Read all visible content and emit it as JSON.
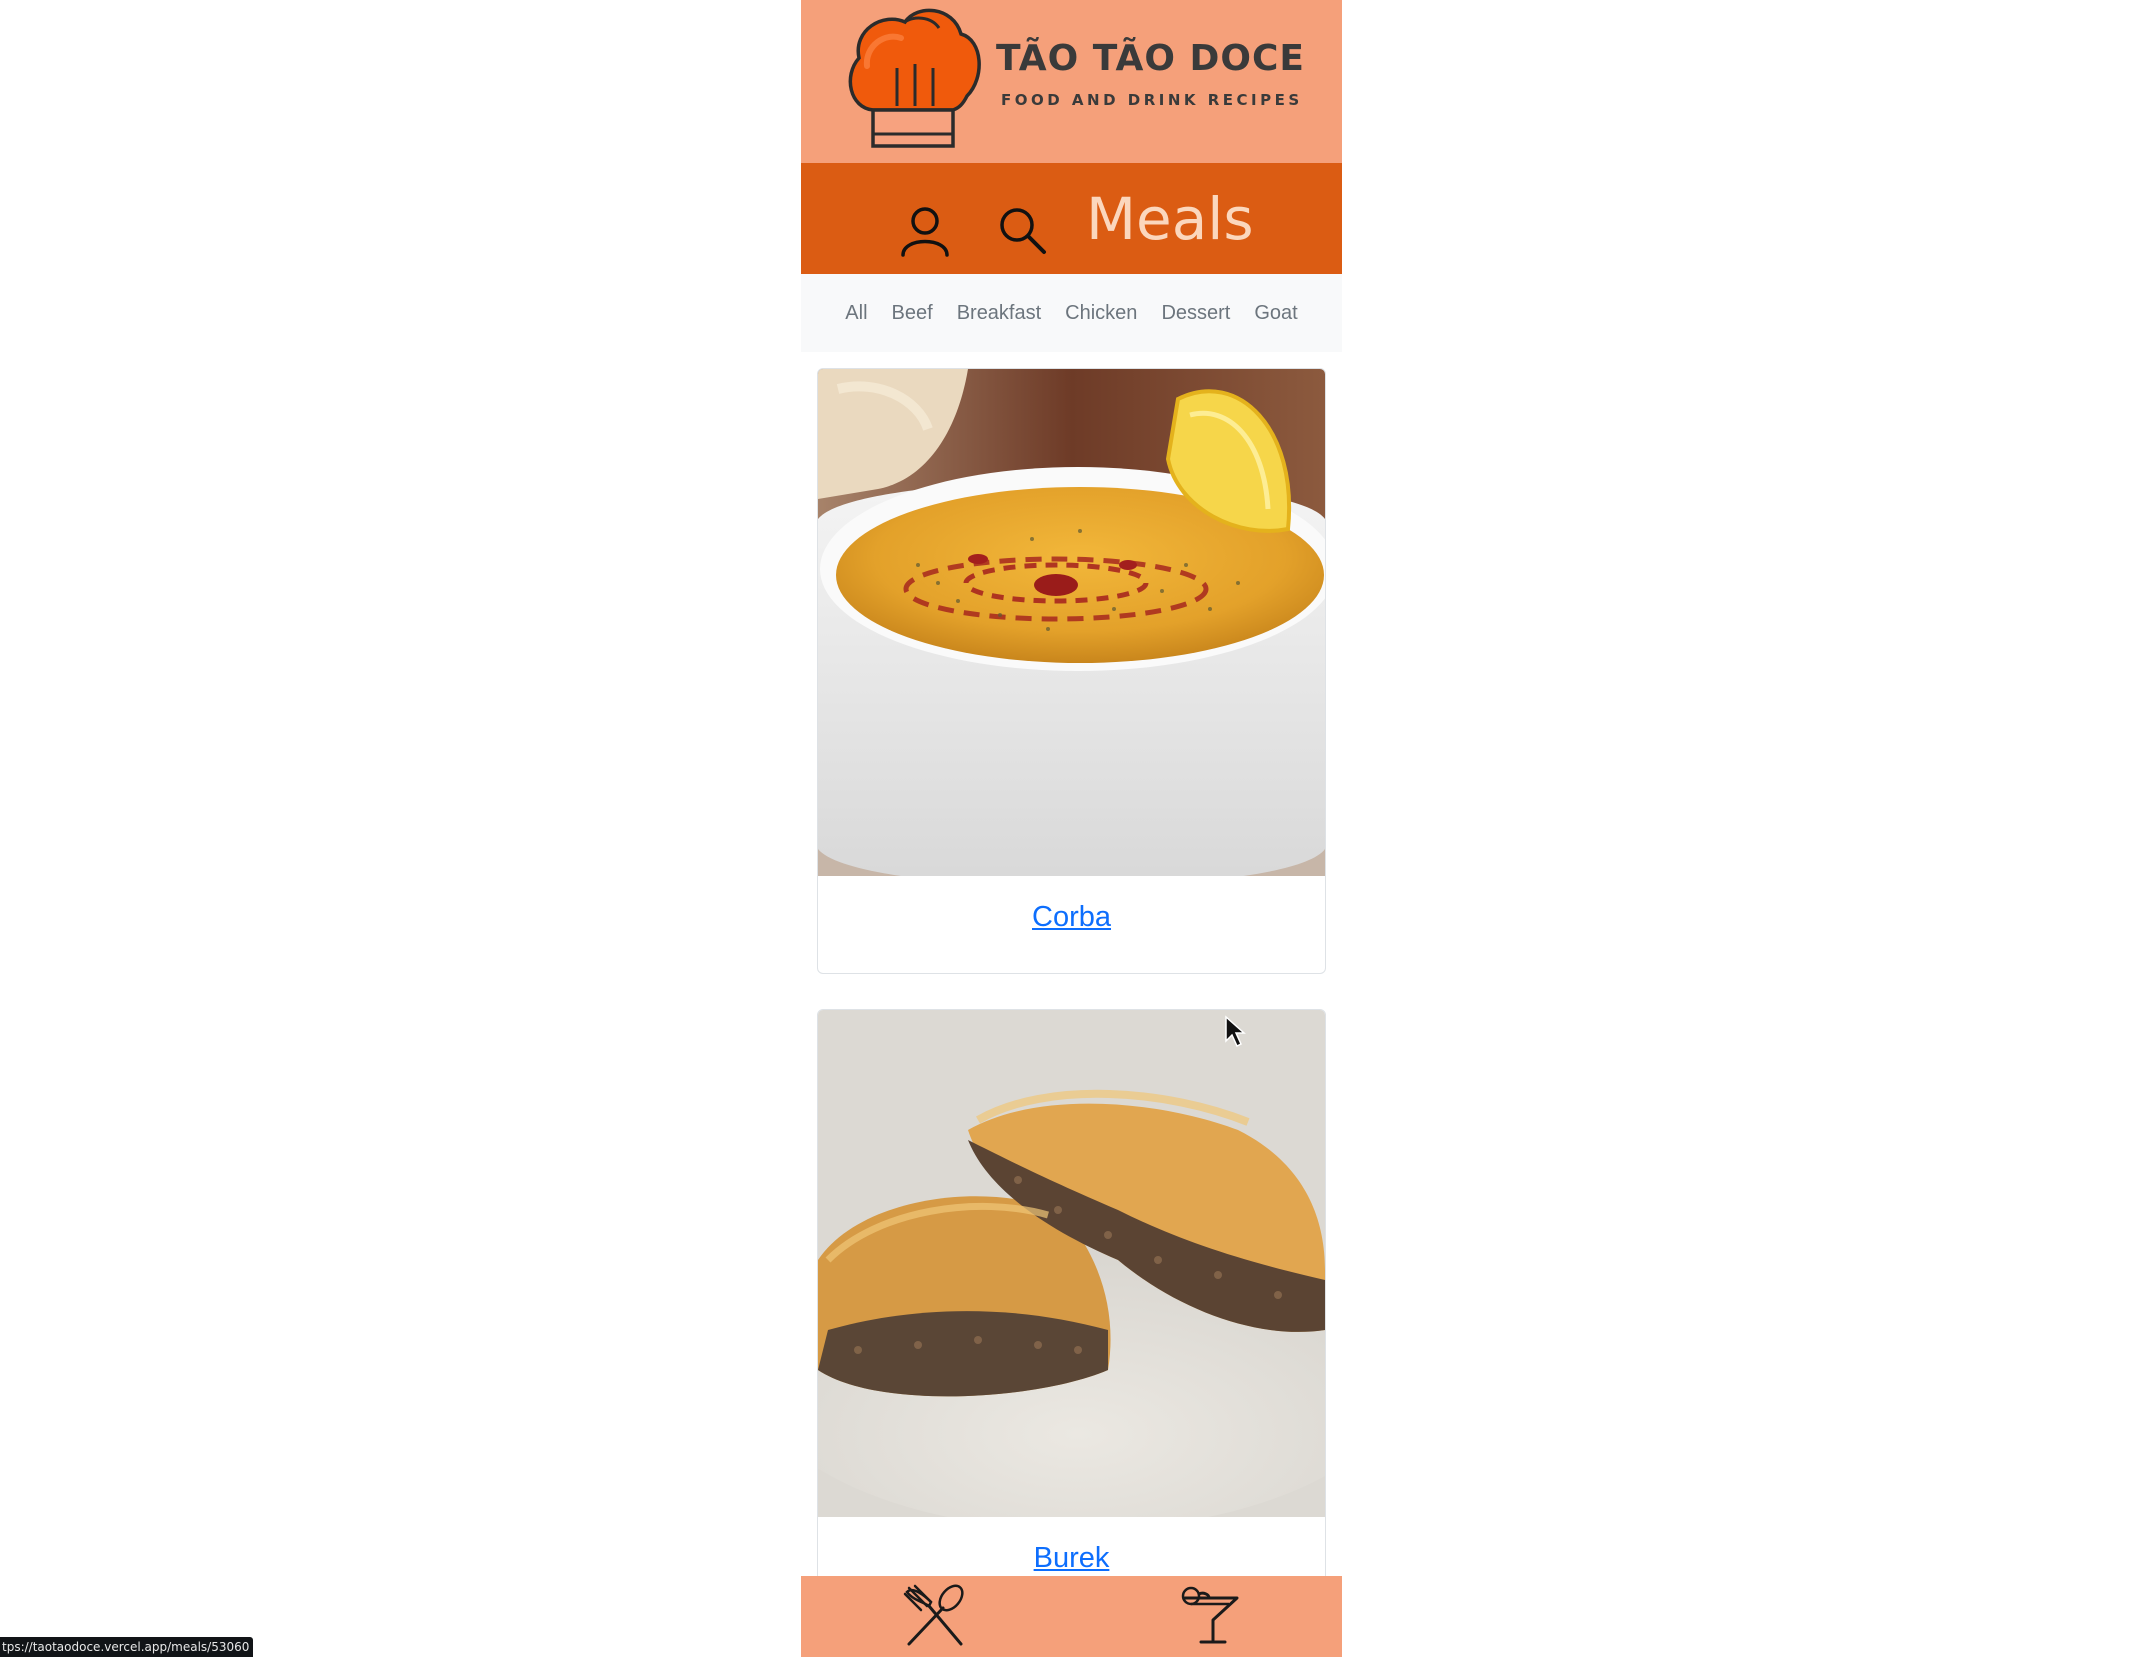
{
  "brand": {
    "title": "TÃO TÃO DOCE",
    "subtitle": "FOOD AND DRINK RECIPES",
    "logo_icon": "chef-hat-icon",
    "colors": {
      "bar": "#f5a07a",
      "hat": "#f05a0c",
      "hat_dark": "#d94a05",
      "band": "#f7a27f"
    }
  },
  "nav": {
    "profile_icon": "user-icon",
    "search_icon": "search-icon",
    "title": "Meals",
    "colors": {
      "background": "#db5c13",
      "title": "#fbd7bd"
    }
  },
  "filters": [
    "All",
    "Beef",
    "Breakfast",
    "Chicken",
    "Dessert",
    "Goat"
  ],
  "meals": [
    {
      "name": "Corba",
      "image": "lentil-soup-bowl"
    },
    {
      "name": "Burek",
      "image": "meat-pastry-slices"
    }
  ],
  "tabbar": {
    "meals_icon": "fork-and-spoon-icon",
    "drinks_icon": "cocktail-glass-icon"
  },
  "status_bar": {
    "url": "tps://taotaodoce.vercel.app/meals/53060"
  }
}
